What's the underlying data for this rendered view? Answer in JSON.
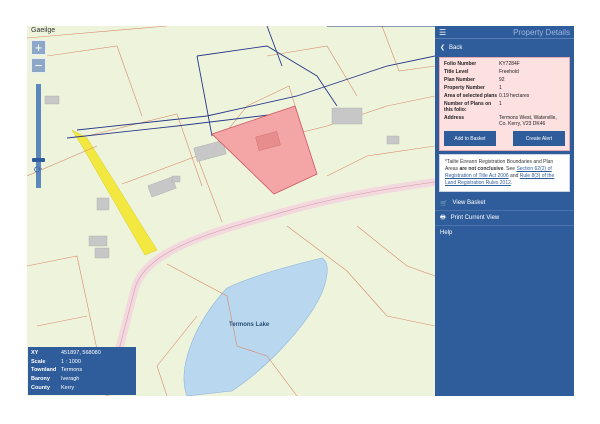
{
  "map": {
    "language_link": "Gaeilge",
    "zoom_in": "+",
    "zoom_out": "−",
    "lake_label": "Termons Lake"
  },
  "info_box": {
    "rows": [
      {
        "label": "XY",
        "value": "451897, 568080"
      },
      {
        "label": "Scale",
        "value": "1 : 1000"
      },
      {
        "label": "Townland",
        "value": "Termons"
      },
      {
        "label": "Barony",
        "value": "Iveragh"
      },
      {
        "label": "County",
        "value": "Kerry"
      }
    ]
  },
  "panel": {
    "title": "Property Details",
    "back_label": "Back",
    "details": {
      "folio_number": {
        "label": "Folio Number",
        "value": "KY7284F"
      },
      "title_level": {
        "label": "Title Level",
        "value": "Freehold"
      },
      "plan_number": {
        "label": "Plan Number",
        "value": "92"
      },
      "property_number": {
        "label": "Property Number",
        "value": "1"
      },
      "area": {
        "label": "Area of selected plans",
        "value": "0.19 hectares"
      },
      "num_plans": {
        "label": "Number of Plans on this folio:",
        "value": "1"
      },
      "address": {
        "label": "Address",
        "value": "Termons West, Waterville, Co. Kerry, V23 DK46"
      }
    },
    "add_to_basket": "Add to Basket",
    "create_alert": "Create Alert",
    "note": {
      "part1": "*Tailte Éireann Registration Boundaries and Plan Areas",
      "bold": "are not conclusive",
      "part2": ". See",
      "link1": "Section 62(2) of Registration of Title Act 2006",
      "and": "and",
      "link2": "Rule 8(3) of the Land Registration Rules 2012",
      "end": "."
    },
    "menu": [
      {
        "label": "View Basket"
      },
      {
        "label": "Print Current View"
      },
      {
        "label": "Help"
      }
    ]
  },
  "colors": {
    "panel_blue": "#2f5d9b",
    "selected_parcel": "#f4a6a6",
    "lake": "#b9d7ee",
    "road_yellow": "#f2e840"
  }
}
